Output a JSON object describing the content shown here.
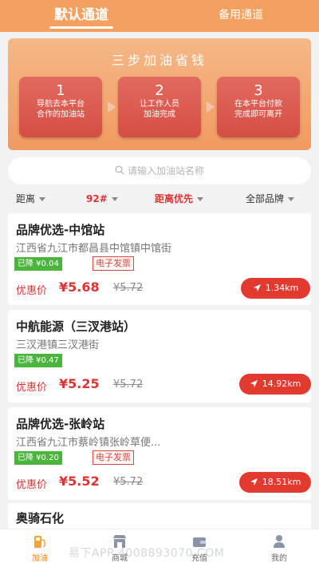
{
  "tabs": {
    "default": "默认通道",
    "backup": "备用通道"
  },
  "banner": {
    "title": "三步加油省钱",
    "steps": [
      {
        "num": "1",
        "line1": "导航去本平台",
        "line2": "合作的加油站"
      },
      {
        "num": "2",
        "line1": "让工作人员",
        "line2": "加油完成"
      },
      {
        "num": "3",
        "line1": "在本平台付款",
        "line2": "完成即可离开"
      }
    ]
  },
  "search": {
    "placeholder": "请输入加油站名称"
  },
  "filters": {
    "distance": "距离",
    "fuel": "92#",
    "sort": "距离优先",
    "brand": "全部品牌"
  },
  "stations": [
    {
      "name": "品牌优选-中馆站",
      "address": "江西省九江市都昌县中馆镇中馆街",
      "drop": "已降 ¥0.04",
      "invoice": "电子发票",
      "price_label": "优惠价",
      "price": "¥5.68",
      "old_price": "¥5.72",
      "distance": "1.34km"
    },
    {
      "name": "中航能源（三汊港站）",
      "address": "三汊港镇三汊港街",
      "drop": "已降 ¥0.47",
      "invoice": "",
      "price_label": "优惠价",
      "price": "¥5.25",
      "old_price": "¥5.72",
      "distance": "14.92km"
    },
    {
      "name": "品牌优选-张岭站",
      "address": "江西省九江市蔡岭镇张岭草便...",
      "drop": "已降 ¥0.20",
      "invoice": "电子发票",
      "price_label": "优惠价",
      "price": "¥5.52",
      "old_price": "¥5.72",
      "distance": "18.51km"
    },
    {
      "name": "奥骑石化"
    }
  ],
  "tabbar": [
    {
      "label": "加油",
      "icon": "fuel-pump-icon",
      "active": true
    },
    {
      "label": "商城",
      "icon": "store-icon"
    },
    {
      "label": "充值",
      "icon": "wallet-icon"
    },
    {
      "label": "我的",
      "icon": "user-icon"
    }
  ],
  "watermark": "易下APP 4008893070.COM",
  "colors": {
    "header": "#f3a060",
    "accent_red": "#e33a2f",
    "drop_green": "#4ab43c",
    "active_tab": "#f08a2c"
  }
}
